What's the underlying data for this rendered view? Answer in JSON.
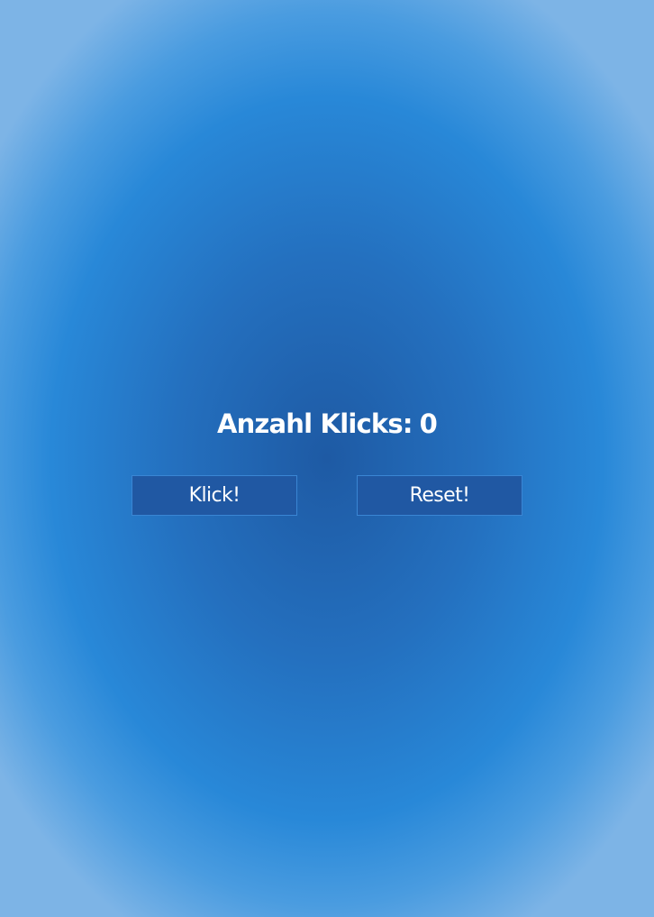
{
  "counter": {
    "label": "Anzahl Klicks:",
    "value": "0"
  },
  "buttons": {
    "klick_label": "Klick!",
    "reset_label": "Reset!"
  },
  "colors": {
    "button_background": "#2058a3",
    "button_border": "#3a86d4",
    "background_center": "#1e5aa4",
    "background_edge": "#7db4e6",
    "text": "#ffffff"
  }
}
